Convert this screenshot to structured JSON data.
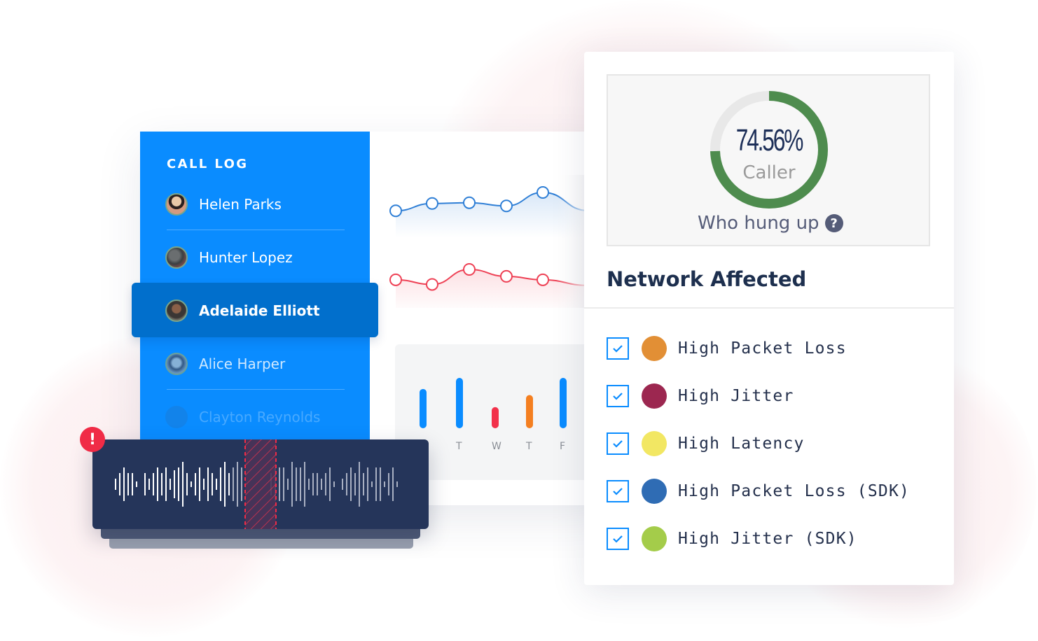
{
  "call_log": {
    "title": "CALL LOG",
    "callers": [
      {
        "name": "Helen Parks",
        "active": false,
        "faded": false
      },
      {
        "name": "Hunter Lopez",
        "active": false,
        "faded": false
      },
      {
        "name": "Adelaide Elliott",
        "active": true,
        "faded": false
      },
      {
        "name": "Alice Harper",
        "active": false,
        "faded": false
      },
      {
        "name": "Clayton Reynolds",
        "active": false,
        "faded": true
      }
    ]
  },
  "line_chart": {
    "series": [
      {
        "name": "blue",
        "color": "#2f7fd6",
        "values": [
          0.25,
          0.55,
          0.58,
          0.45,
          1.0
        ]
      },
      {
        "name": "red",
        "color": "#ee4155",
        "values": [
          0.55,
          0.35,
          1.0,
          0.7,
          0.55
        ]
      }
    ]
  },
  "bar_chart": {
    "categories": [
      "",
      "T",
      "W",
      "T",
      "F"
    ],
    "bars": [
      {
        "value": 0.78,
        "color": "#0a8cff"
      },
      {
        "value": 1.0,
        "color": "#0a8cff"
      },
      {
        "value": 0.42,
        "color": "#f2304a"
      },
      {
        "value": 0.66,
        "color": "#f47f20"
      },
      {
        "value": 1.0,
        "color": "#0a8cff"
      }
    ]
  },
  "waveform": {
    "alert_icon": "!",
    "highlight_color": "#f02b46"
  },
  "hangup": {
    "percent_label": "74.56%",
    "percent_value": 74.56,
    "party": "Caller",
    "question": "Who hung up",
    "help_icon": "?",
    "ring_color": "#4e8c4e",
    "track_color": "#e8e8e8"
  },
  "network": {
    "title": "Network Affected",
    "items": [
      {
        "label": "High Packet Loss",
        "color": "#e28f35",
        "checked": true
      },
      {
        "label": "High Jitter",
        "color": "#9c2750",
        "checked": true
      },
      {
        "label": "High Latency",
        "color": "#f2e763",
        "checked": true
      },
      {
        "label": "High Packet Loss (SDK)",
        "color": "#2f6cb4",
        "checked": true
      },
      {
        "label": "High Jitter (SDK)",
        "color": "#a4cc4a",
        "checked": true
      }
    ]
  }
}
